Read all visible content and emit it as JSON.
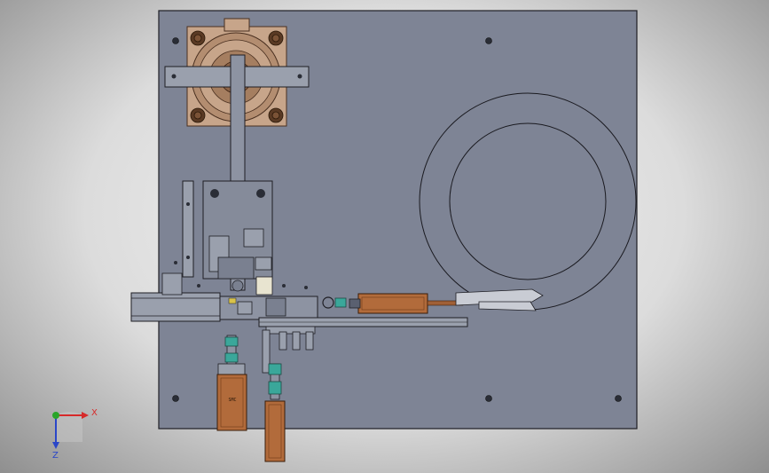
{
  "viewport": {
    "background": "gradient-grey"
  },
  "colors": {
    "plate": "#7e8495",
    "plate_edge": "#1e1e24",
    "copper": "#b26b3b",
    "copper_dark": "#6e3a18",
    "bearing": "#c7a58a",
    "fitting": "#3aa79a",
    "steel": "#9aa0ad",
    "axis_x": "#d62a2a",
    "axis_y": "#2aa52a",
    "axis_z": "#2a46c8"
  },
  "icons": {
    "triad": "coordinate-triad-icon"
  },
  "cylinder_label": "SMC",
  "triad": {
    "x_label": "X",
    "z_label": "Z"
  }
}
